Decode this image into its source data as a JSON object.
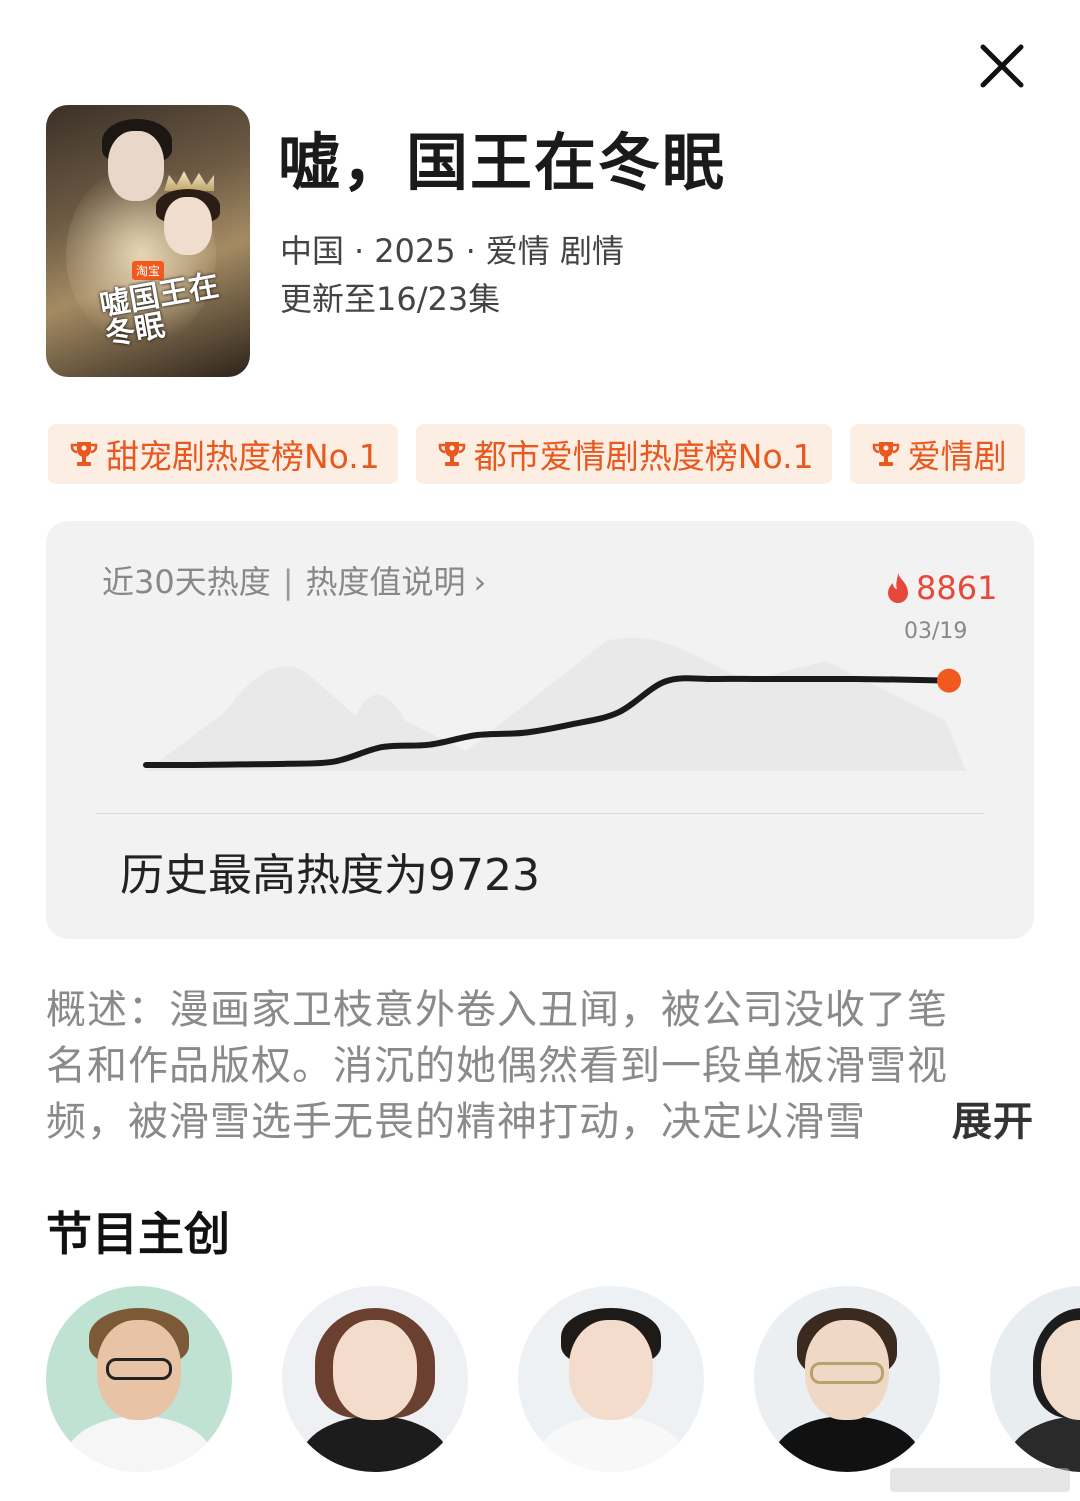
{
  "header": {
    "title": "嘘，国王在冬眠",
    "country": "中国",
    "year": "2025",
    "genres": "爱情 剧情",
    "update_status": "更新至16/23集",
    "close_icon": "close-icon"
  },
  "poster": {
    "tag": "淘宝",
    "logo_text": "嘘国王在冬眠"
  },
  "badges": [
    {
      "label": "甜宠剧热度榜No.1",
      "icon": "trophy-icon"
    },
    {
      "label": "都市爱情剧热度榜No.1",
      "icon": "trophy-icon"
    },
    {
      "label": "爱情剧",
      "icon": "trophy-icon"
    }
  ],
  "heat": {
    "title": "近30天热度",
    "separator": "|",
    "help_link": "热度值说明",
    "current_value": "8861",
    "current_date": "03/19",
    "record_text": "历史最高热度为9723",
    "accent_color": "#e8483a",
    "dot_color": "#f05a1e"
  },
  "chart_data": {
    "type": "line",
    "title": "近30天热度",
    "series": [
      {
        "values": [
          1800,
          1800,
          1850,
          1900,
          2100,
          3300,
          3500,
          4300,
          4500,
          5200,
          6200,
          8800,
          9000,
          9000,
          9000,
          9000,
          8950,
          8861
        ]
      }
    ],
    "last_point": {
      "label": "03/19",
      "value": 8861
    },
    "max_value": 9723,
    "grid": false
  },
  "summary": {
    "lines": [
      "概述：漫画家卫枝意外卷入丑闻，被公司没收了笔",
      "名和作品版权。消沉的她偶然看到一段单板滑雪视",
      "频，被滑雪选手无畏的精神打动，决定以滑雪"
    ],
    "expand_label": "展开"
  },
  "creators": {
    "section_title": "节目主创",
    "count_visible": 5
  }
}
